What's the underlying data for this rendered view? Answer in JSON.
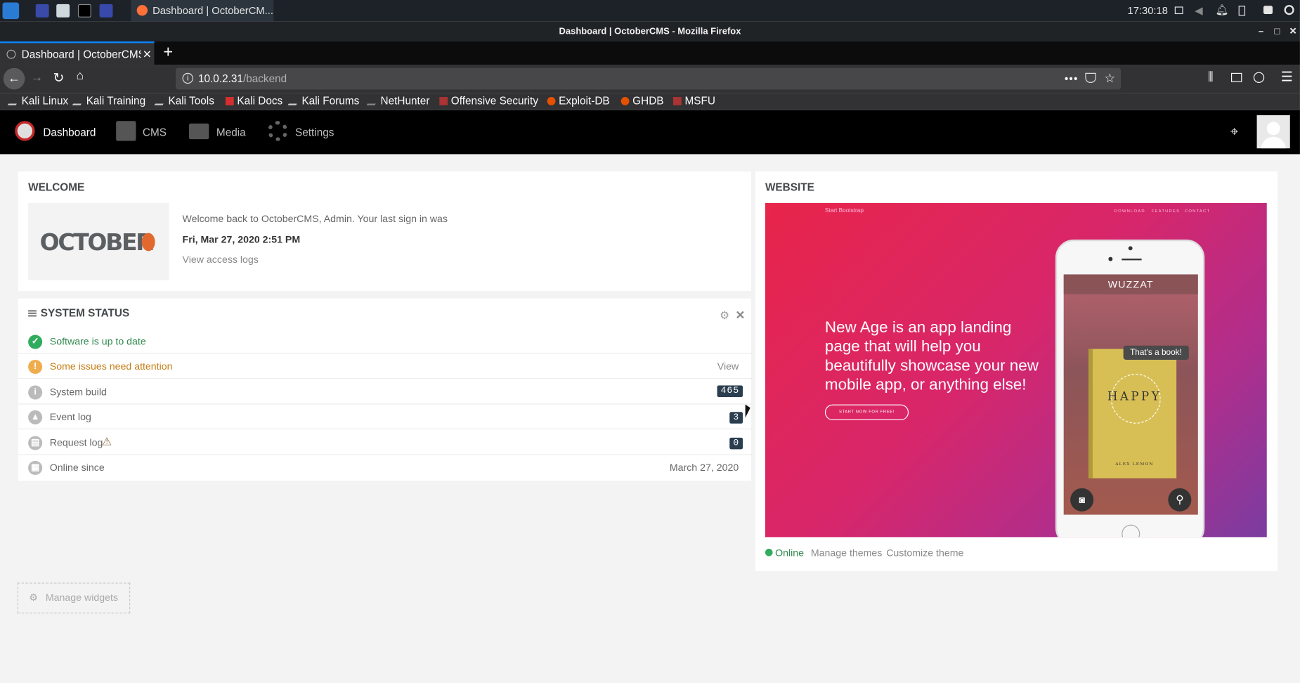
{
  "system": {
    "time": "17:30:18",
    "taskbar_item": "Dashboard | OctoberCM..."
  },
  "window": {
    "title": "Dashboard | OctoberCMS - Mozilla Firefox"
  },
  "browser": {
    "tab_title": "Dashboard | OctoberCMS",
    "url_host": "10.0.2.31",
    "url_path": "/backend",
    "bookmarks": [
      "Kali Linux",
      "Kali Training",
      "Kali Tools",
      "Kali Docs",
      "Kali Forums",
      "NetHunter",
      "Offensive Security",
      "Exploit-DB",
      "GHDB",
      "MSFU"
    ]
  },
  "app": {
    "nav": [
      "Dashboard",
      "CMS",
      "Media",
      "Settings"
    ]
  },
  "welcome": {
    "title": "WELCOME",
    "logo_text": "OCTOBER",
    "message": "Welcome back to OctoberCMS, Admin. Your last sign in was",
    "last_sign_in": "Fri, Mar 27, 2020 2:51 PM",
    "access_logs_link": "View access logs"
  },
  "system_status": {
    "title": "SYSTEM STATUS",
    "rows": [
      {
        "label": "Software is up to date",
        "value": ""
      },
      {
        "label": "Some issues need attention",
        "value": "View"
      },
      {
        "label": "System build",
        "value": "465"
      },
      {
        "label": "Event log",
        "value": "3"
      },
      {
        "label": "Request log",
        "value": "0"
      },
      {
        "label": "Online since",
        "value": "March 27, 2020"
      }
    ]
  },
  "manage_widgets": "Manage widgets",
  "website": {
    "title": "WEBSITE",
    "preview": {
      "brand": "Start Bootstrap",
      "menu": [
        "DOWNLOAD",
        "FEATURES",
        "CONTACT"
      ],
      "headline": "New Age is an app landing page that will help you beautifully showcase your new mobile app, or anything else!",
      "cta": "START NOW FOR FREE!",
      "phone_app": "WUZZAT",
      "bubble": "That's a book!",
      "book_title": "HAPPY",
      "book_author": "ALEX LEMON"
    },
    "status": "Online",
    "manage_themes": "Manage themes",
    "customize_theme": "Customize theme"
  },
  "colors": {
    "accent": "#0a84ff",
    "ok": "#31ac5f",
    "warn": "#f0ad4e",
    "badge": "#2b3e50"
  }
}
